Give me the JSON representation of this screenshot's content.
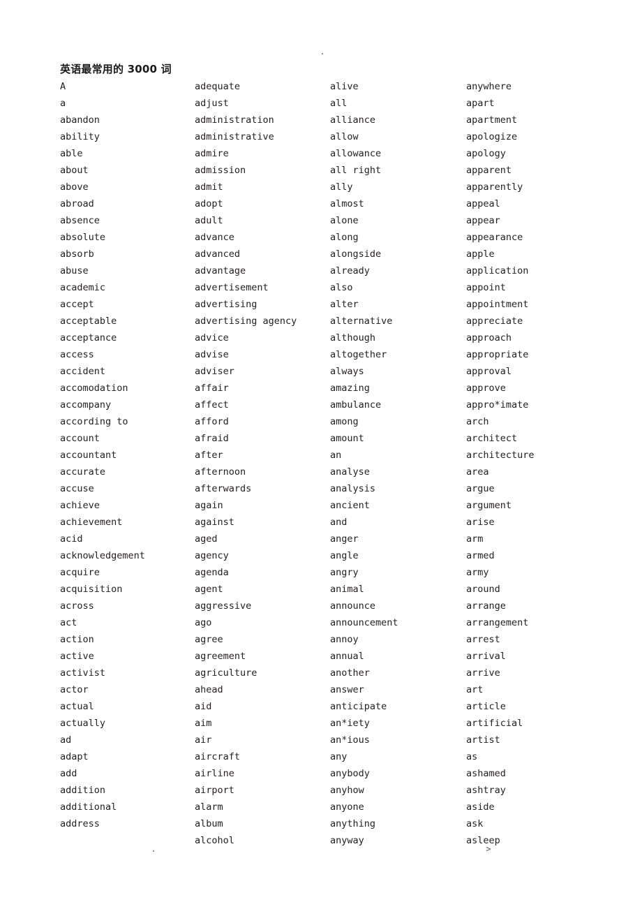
{
  "document": {
    "title": "英语最常用的 3000 词",
    "header_mark": ".",
    "footer_mark_left": ".",
    "footer_mark_right": ">"
  },
  "columns": [
    {
      "name": "column-1",
      "words": [
        "A",
        "a",
        "abandon",
        "ability",
        "able",
        "about",
        "above",
        "abroad",
        "absence",
        "absolute",
        "absorb",
        "abuse",
        "academic",
        "accept",
        "acceptable",
        "acceptance",
        "access",
        "accident",
        "accomodation",
        "accompany",
        "according to",
        "account",
        "accountant",
        "accurate",
        "accuse",
        "achieve",
        "achievement",
        "acid",
        "acknowledgement",
        "acquire",
        "acquisition",
        "across",
        "act",
        "action",
        "active",
        "activist",
        "actor",
        "actual",
        "actually",
        "ad",
        "adapt",
        "add",
        "addition",
        "additional",
        "address"
      ]
    },
    {
      "name": "column-2",
      "words": [
        "adequate",
        "adjust",
        "administration",
        "administrative",
        "admire",
        "admission",
        "admit",
        "adopt",
        "adult",
        "advance",
        "advanced",
        "advantage",
        "advertisement",
        "advertising",
        "advertising agency",
        "advice",
        "advise",
        "adviser",
        "affair",
        "affect",
        "afford",
        "afraid",
        "after",
        "afternoon",
        "afterwards",
        "again",
        "against",
        "aged",
        "agency",
        "agenda",
        "agent",
        "aggressive",
        "ago",
        "agree",
        "agreement",
        "agriculture",
        "ahead",
        "aid",
        "aim",
        "air",
        "aircraft",
        "airline",
        "airport",
        "alarm",
        "album",
        "alcohol"
      ]
    },
    {
      "name": "column-3",
      "words": [
        "alive",
        "all",
        "alliance",
        "allow",
        "allowance",
        "all right",
        "ally",
        "almost",
        "alone",
        "along",
        "alongside",
        "already",
        "also",
        "alter",
        "alternative",
        "although",
        "altogether",
        "always",
        "amazing",
        "ambulance",
        "among",
        "amount",
        "an",
        "analyse",
        "analysis",
        "ancient",
        "and",
        "anger",
        "angle",
        "angry",
        "animal",
        "announce",
        "announcement",
        "annoy",
        "annual",
        "another",
        "answer",
        "anticipate",
        "an*iety",
        "an*ious",
        "any",
        "anybody",
        "anyhow",
        "anyone",
        "anything",
        "anyway"
      ]
    },
    {
      "name": "column-4",
      "words": [
        "anywhere",
        "apart",
        "apartment",
        "apologize",
        "apology",
        "apparent",
        "apparently",
        "appeal",
        "appear",
        "appearance",
        "apple",
        "application",
        "appoint",
        "appointment",
        "appreciate",
        "approach",
        "appropriate",
        "approval",
        "approve",
        "appro*imate",
        "arch",
        "architect",
        "architecture",
        "area",
        "argue",
        "argument",
        "arise",
        "arm",
        "armed",
        "army",
        "around",
        "arrange",
        "arrangement",
        "arrest",
        "arrival",
        "arrive",
        "art",
        "article",
        "artificial",
        "artist",
        "as",
        "ashamed",
        "ashtray",
        "aside",
        "ask",
        "asleep"
      ]
    }
  ]
}
